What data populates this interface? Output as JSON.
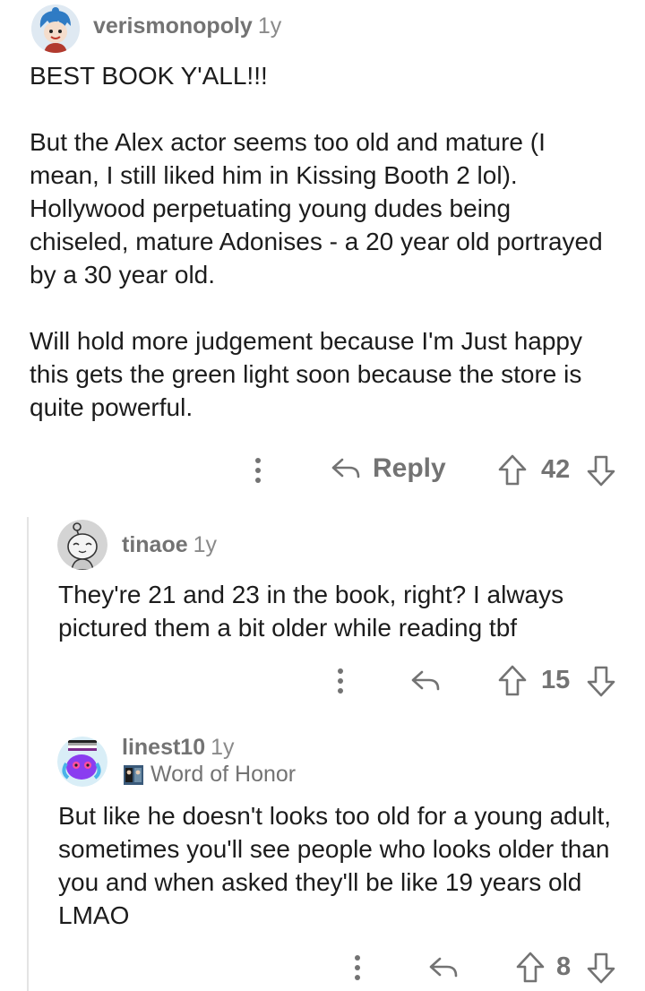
{
  "comments": [
    {
      "username": "verismonopoly",
      "age": "1y",
      "paragraphs": [
        "BEST BOOK Y'ALL!!!",
        "But the Alex actor seems too old and mature (I mean, I still liked him in Kissing Booth 2 lol). Hollywood perpetuating young dudes being chiseled, mature Adonises - a 20 year old portrayed by a 30 year old.",
        "Will hold more judgement because I'm Just happy this gets the green light soon because the store is quite powerful."
      ],
      "reply_label": "Reply",
      "score": "42"
    },
    {
      "username": "tinaoe",
      "age": "1y",
      "paragraphs": [
        "They're 21 and 23 in the book, right? I always pictured them a bit older while reading tbf"
      ],
      "score": "15"
    },
    {
      "username": "linest10",
      "age": "1y",
      "flair": "Word of Honor",
      "paragraphs": [
        "But like he doesn't looks too old for a young adult, sometimes you'll see people who looks older than you and when asked they'll be like 19 years old LMAO"
      ],
      "score": "8"
    }
  ],
  "colors": {
    "meta_text": "#737373",
    "body_text": "#1c1c1c",
    "thread_line": "#e4e4e4"
  },
  "icons": [
    "more-options-icon",
    "reply-arrow-icon",
    "upvote-icon",
    "downvote-icon"
  ]
}
